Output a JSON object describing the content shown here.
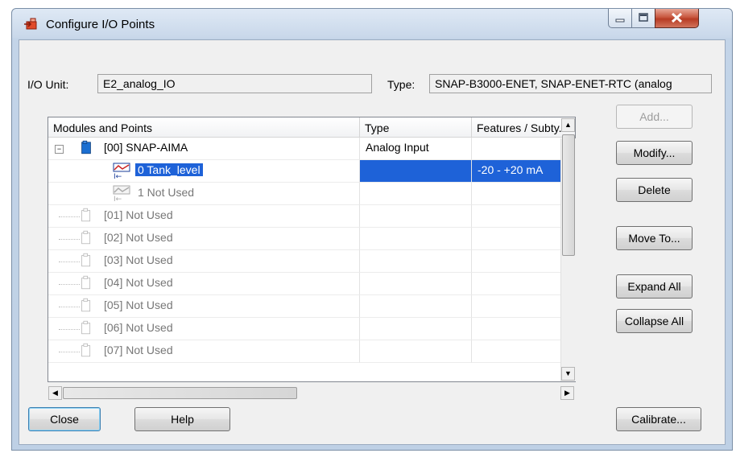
{
  "window": {
    "title": "Configure I/O Points"
  },
  "io_unit": {
    "label": "I/O Unit:",
    "value": "E2_analog_IO"
  },
  "type_field": {
    "label": "Type:",
    "value": "SNAP-B3000-ENET, SNAP-ENET-RTC  (analog"
  },
  "tree": {
    "columns": [
      "Modules and Points",
      "Type",
      "Features / Subty..."
    ],
    "rows": [
      {
        "name": "[00] SNAP-AIMA",
        "type": "Analog Input",
        "feature": ""
      },
      {
        "name": "0  Tank_level",
        "type": "",
        "feature": "-20 - +20 mA"
      },
      {
        "name": "1  Not Used",
        "type": "",
        "feature": ""
      },
      {
        "name": "[01] Not Used",
        "type": "",
        "feature": ""
      },
      {
        "name": "[02] Not Used",
        "type": "",
        "feature": ""
      },
      {
        "name": "[03] Not Used",
        "type": "",
        "feature": ""
      },
      {
        "name": "[04] Not Used",
        "type": "",
        "feature": ""
      },
      {
        "name": "[05] Not Used",
        "type": "",
        "feature": ""
      },
      {
        "name": "[06] Not Used",
        "type": "",
        "feature": ""
      },
      {
        "name": "[07] Not Used",
        "type": "",
        "feature": ""
      }
    ],
    "expander": "−"
  },
  "buttons": {
    "add": "Add...",
    "modify": "Modify...",
    "delete": "Delete",
    "move_to": "Move To...",
    "expand_all": "Expand All",
    "collapse_all": "Collapse All",
    "close": "Close",
    "help": "Help",
    "calibrate": "Calibrate..."
  },
  "icons": {
    "app": "io-points-icon",
    "module": "module-icon",
    "point": "analog-point-icon"
  },
  "colors": {
    "selection": "#1e62d8",
    "close_button": "#c8573f"
  }
}
